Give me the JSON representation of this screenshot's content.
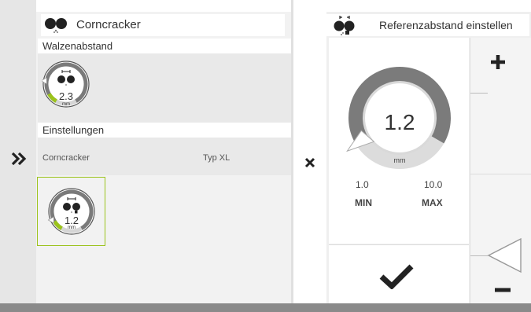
{
  "left": {
    "title": "Corncracker",
    "section1_label": "Walzenabstand",
    "gauge1": {
      "value": "2.3",
      "unit": "mm",
      "level": 0.23
    },
    "section2_label": "Einstellungen",
    "setting_row": {
      "name": "Corncracker",
      "value": "Typ XL"
    },
    "gauge2": {
      "value": "1.2",
      "unit": "mm",
      "level": 0.12
    }
  },
  "right": {
    "title": "Referenzabstand einstellen",
    "dial": {
      "value": "1.2",
      "unit": "mm",
      "min_value": "1.0",
      "max_value": "10.0",
      "min_label": "MIN",
      "max_label": "MAX",
      "level": 0.0222
    }
  },
  "icons": {
    "expand": "double-chevron-right-icon",
    "close": "close-x-icon",
    "confirm": "checkmark-icon",
    "increase": "plus-icon",
    "decrease": "minus-icon"
  },
  "colors": {
    "accent": "#9bc31c",
    "dark_ring": "#777777",
    "light_ring": "#d9d9d9"
  }
}
